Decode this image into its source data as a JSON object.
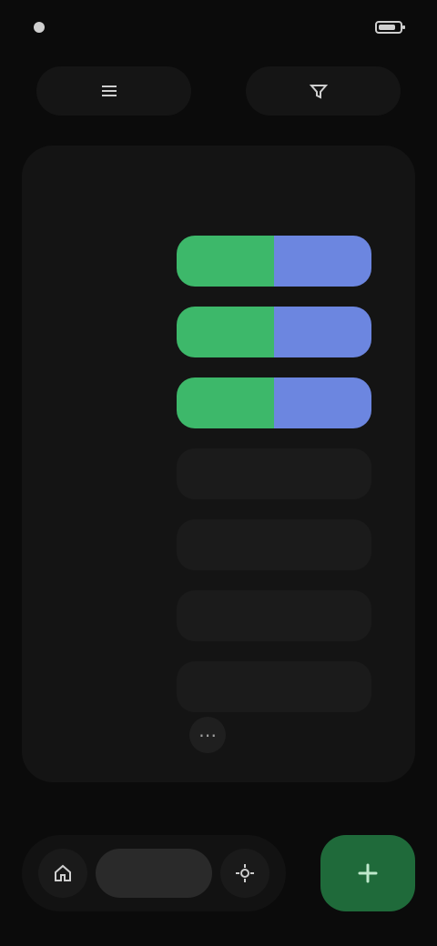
{
  "statusbar": {
    "time": "",
    "battery_label": ""
  },
  "topbar": {
    "left_label": "",
    "right_label": ""
  },
  "card": {
    "title": "",
    "meta": "",
    "rows": [
      {
        "label": "",
        "green_fraction": 0.5,
        "blue_fraction": 0.5
      },
      {
        "label": "",
        "green_fraction": 0.5,
        "blue_fraction": 0.5
      },
      {
        "label": "",
        "green_fraction": 0.5,
        "blue_fraction": 0.5
      },
      {
        "label": "",
        "green_fraction": 0.0,
        "blue_fraction": 0.0
      },
      {
        "label": "",
        "green_fraction": 0.0,
        "blue_fraction": 0.0
      },
      {
        "label": "",
        "green_fraction": 0.0,
        "blue_fraction": 0.0
      },
      {
        "label": "",
        "green_fraction": 0.0,
        "blue_fraction": 0.0
      }
    ]
  },
  "bottombar": {
    "middle_label": ""
  },
  "colors": {
    "green": "#3db86a",
    "blue": "#6c86e0",
    "fab": "#1f6a3a"
  },
  "icons": {
    "status_left": "dot-icon",
    "status_right": "battery-icon",
    "topbar_left": "menu-icon",
    "topbar_right": "filter-icon",
    "more": "more-icon",
    "bottom_left": "home-icon",
    "bottom_right": "settings-icon",
    "fab": "plus-icon"
  }
}
